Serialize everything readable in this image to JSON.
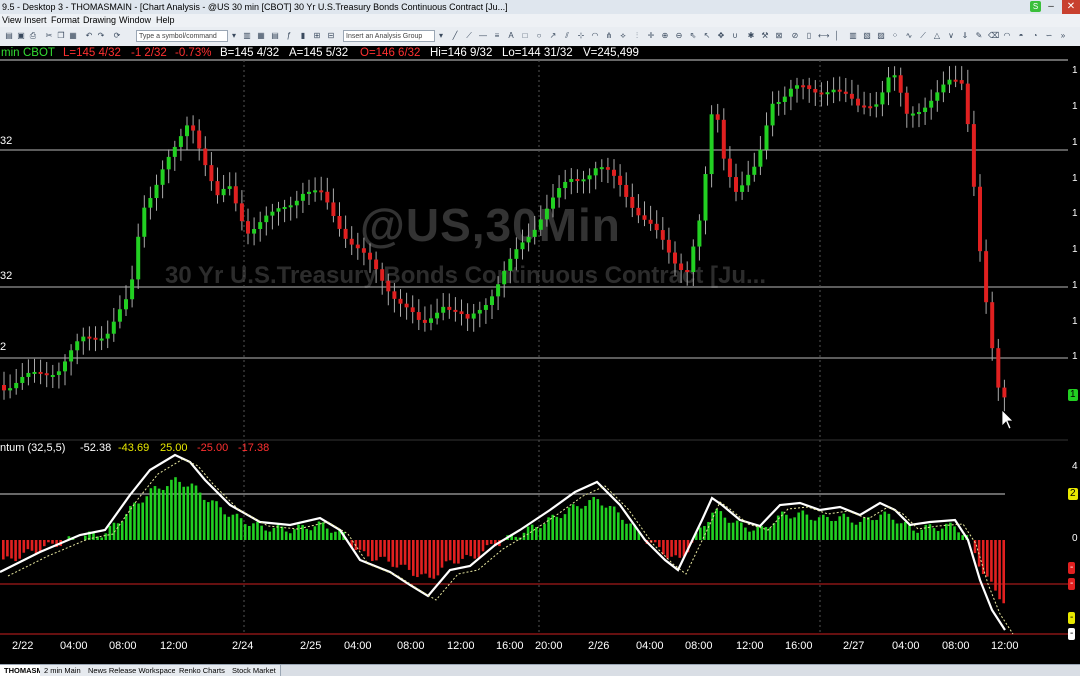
{
  "window": {
    "title": "9.5 - Desktop 3 - THOMASMAIN - [Chart Analysis - @US 30 min [CBOT] 30 Yr U.S.Treasury Bonds Continuous Contract [Ju...]",
    "badge": "S",
    "controls": [
      "–",
      "□",
      "✕"
    ]
  },
  "menu": [
    "View",
    "Insert",
    "Format",
    "Drawing",
    "Window",
    "Help"
  ],
  "toolbar": {
    "symbol_placeholder": "Type a symbol/command",
    "analysis_placeholder": "Insert an Analysis Group"
  },
  "quote": {
    "interval": "min",
    "exchange": "CBOT",
    "last": "L=145 4/32",
    "change": "-1 2/32",
    "pct": "-0.73%",
    "bid": "B=145 4/32",
    "ask": "A=145 5/32",
    "open": "O=146 6/32",
    "high": "Hi=146 9/32",
    "low": "Lo=144 31/32",
    "volume": "V=245,499"
  },
  "watermark": {
    "symbol": "@US,30Min",
    "name": "30 Yr U.S.Treasury Bonds Continuous Contract [Ju..."
  },
  "price_labels": [
    "32",
    "32",
    "2"
  ],
  "momentum": {
    "label": "ntum (32,5,5)",
    "v1": "-52.38",
    "v2": "-43.69",
    "v3": "25.00",
    "v4": "-25.00",
    "v5": "-17.38"
  },
  "right_scale": {
    "price_ticks": [
      "1",
      "1",
      "1",
      "1",
      "1",
      "1",
      "1",
      "1",
      "1"
    ],
    "price_tag": "1",
    "mom_ticks": [
      "4",
      "0"
    ],
    "mom_tags": [
      "2",
      "-",
      "-",
      "-",
      "-"
    ]
  },
  "time_axis": [
    "2/22",
    "04:00",
    "08:00",
    "12:00",
    "2/24",
    "2/25",
    "04:00",
    "08:00",
    "12:00",
    "16:00",
    "20:00",
    "2/26",
    "04:00",
    "08:00",
    "12:00",
    "16:00",
    "2/27",
    "04:00",
    "08:00",
    "12:00"
  ],
  "tabs": [
    "THOMASMAIN",
    "2 min Main",
    "News Release Workspace",
    "Renko Charts",
    "Stock Market"
  ],
  "colors": {
    "up": "#22d022",
    "down": "#e02020",
    "quote_red": "#ff3030",
    "quote_green": "#33dd33",
    "quote_white": "#ffffff",
    "yellow": "#e8e800",
    "background": "#000000",
    "hline": "#b8b8b8"
  },
  "chart_data": {
    "type": "candlestick",
    "momentum_histogram_note": "momentum oscillator with histogram and signal line",
    "price_lines": [
      "upper",
      "middle",
      "lower"
    ]
  }
}
